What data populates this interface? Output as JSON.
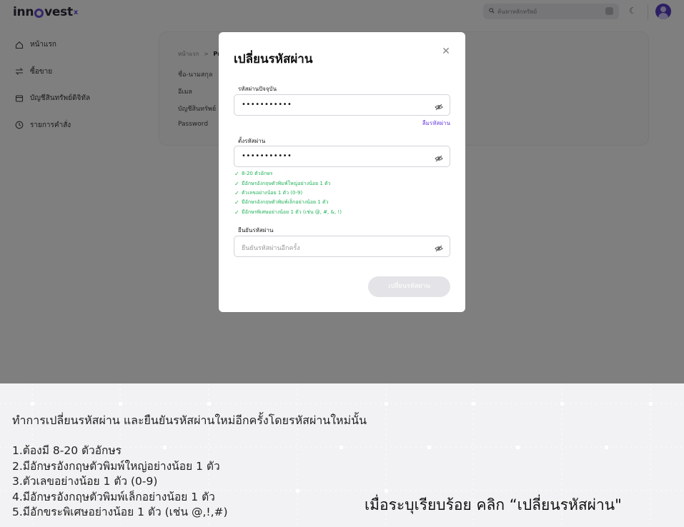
{
  "app": {
    "logo": {
      "text_main": "inn",
      "text_end": "vest",
      "mark": "x"
    },
    "search": {
      "placeholder": "ค้นหาหลักทรัพย์"
    },
    "sidebar": {
      "items": [
        {
          "label": "หน้าแรก",
          "icon": "home-icon"
        },
        {
          "label": "ซื้อขาย",
          "icon": "swap-icon"
        },
        {
          "label": "บัญชีสินทรัพย์ดิจิทัล",
          "icon": "wallet-icon"
        },
        {
          "label": "รายการคำสั่ง",
          "icon": "clock-icon"
        }
      ]
    },
    "breadcrumb": {
      "home": "หน้าแรก",
      "sep": ">",
      "current": "Pro"
    },
    "profile_fields": [
      "ชื่อ-นามสกุล",
      "อีเมล",
      "บัญชีสินทรัพย์",
      "Password"
    ]
  },
  "modal": {
    "title": "เปลี่ยนรหัสผ่าน",
    "current_password": {
      "label": "รหัสผ่านปัจจุบัน",
      "value": "•••••••••••"
    },
    "forgot_link": "ลืมรหัสผ่าน",
    "new_password": {
      "label": "ตั้งรหัสผ่าน",
      "value": "•••••••••••"
    },
    "rules": [
      "8-20 ตัวอักษร",
      "มีอักษรอังกฤษตัวพิมพ์ใหญ่อย่างน้อย 1 ตัว",
      "ตัวเลขอย่างน้อย 1 ตัว (0-9)",
      "มีอักษรอังกฤษตัวพิมพ์เล็กอย่างน้อย 1 ตัว",
      "มีอักษรพิเศษอย่างน้อย 1 ตัว (เช่น @, #, &, !)"
    ],
    "confirm_password": {
      "label": "ยืนยันรหัสผ่าน",
      "placeholder": "ยืนยันรหัสผ่านอีกครั้ง"
    },
    "submit_label": "เปลี่ยนรหัสผ่าน"
  },
  "instructions": {
    "heading": "ทำการเปลี่ยนรหัสผ่าน และยืนยันรหัสผ่านใหม่อีกครั้งโดยรหัสผ่านใหม่นั้น",
    "steps": [
      "1.ต้องมี 8-20 ตัวอักษร",
      "2.มีอักษรอังกฤษตัวพิมพ์ใหญ่อย่างน้อย 1 ตัว",
      "3.ตัวเลขอย่างน้อย 1 ตัว (0-9)",
      "4.มีอักษรอังกฤษตัวพิมพ์เล็กอย่างน้อย 1 ตัว",
      "5.มีอักขระพิเศษอย่างน้อย 1 ตัว (เช่น @,!,#)"
    ],
    "cta": "เมื่อระบุเรียบร้อย คลิก “เปลี่ยนรหัสผ่าน\""
  },
  "colors": {
    "accent": "#6b3fe0",
    "success": "#23b25a",
    "overlay": "rgba(0,0,0,0.5)"
  }
}
